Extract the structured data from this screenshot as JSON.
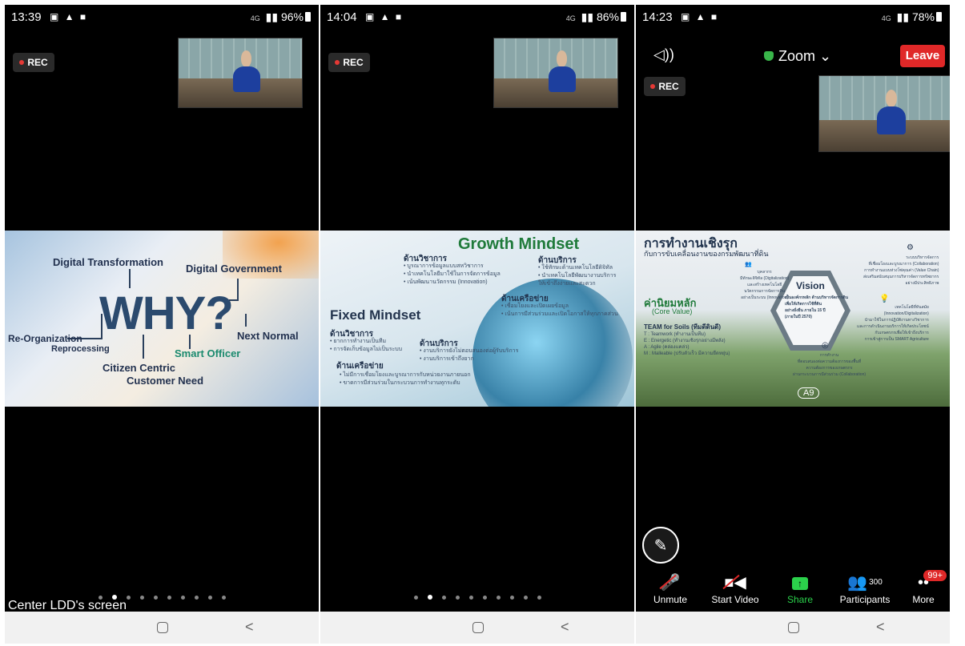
{
  "phone1": {
    "status": {
      "time": "13:39",
      "icons": "▣ ▲ ■",
      "network": "4G",
      "signal": "▮▮",
      "battery": "96%"
    },
    "rec": "REC",
    "slide": {
      "word": "WHY?",
      "labels": [
        "Digital Transformation",
        "Digital Government",
        "Re-Organization",
        "Reprocessing",
        "Next Normal",
        "Smart Officer",
        "Citizen Centric",
        "Customer Need"
      ]
    },
    "caption": "Center LDD's screen"
  },
  "phone2": {
    "status": {
      "time": "14:04",
      "icons": "▣ ▲ ■",
      "network": "4G",
      "signal": "▮▮",
      "battery": "86%"
    },
    "rec": "REC",
    "slide": {
      "growth_title": "Growth Mindset",
      "fixed_title": "Fixed Mindset",
      "g_academic_h": "ด้านวิชาการ",
      "g_academic": [
        "• บูรณาการข้อมูลแบบสหวิชาการ",
        "• นำเทคโนโลยีมาใช้ในการจัดการข้อมูล",
        "• เน้นพัฒนานวัตกรรม (Innovation)"
      ],
      "g_service_h": "ด้านบริการ",
      "g_service": [
        "• ใช้ทักษะด้านเทคโนโลยีดิจิทัล",
        "• นำเทคโนโลยีพัฒนางานบริการ",
        "ให้เข้าถึงง่ายและสะดวก"
      ],
      "g_network_h": "ด้านเครือข่าย",
      "g_network": [
        "• เชื่อมโยงและเปิดเผยข้อมูล",
        "• เน้นการมีส่วนร่วมและเปิดโอกาสให้ทุกภาคส่วน"
      ],
      "f_academic_h": "ด้านวิชาการ",
      "f_academic": [
        "• ยากการทำงานเป็นทีม",
        "• การจัดเก็บข้อมูลไม่เป็นระบบ"
      ],
      "f_service_h": "ด้านบริการ",
      "f_service": [
        "• งานบริการยังไม่ตอบสนองต่อผู้รับบริการ",
        "• งานบริการเข้าถึงยาก"
      ],
      "f_network_h": "ด้านเครือข่าย",
      "f_network": [
        "• ไม่มีการเชื่อมโยงและบูรณาการกับหน่วยงานภายนอก",
        "• ขาดการมีส่วนร่วมในกระบวนการทำงานทุกระดับ"
      ]
    }
  },
  "phone3": {
    "status": {
      "time": "14:23",
      "icons": "▣ ▲ ■",
      "network": "4G",
      "signal": "▮▮",
      "battery": "78%"
    },
    "meeting_title": "Zoom",
    "leave_label": "Leave",
    "rec": "REC",
    "slide": {
      "title": "การทำงานเชิงรุก",
      "subtitle": "กับการขับเคลื่อนงานของกรมพัฒนาที่ดิน",
      "vision": "Vision",
      "vision_text": [
        "เป็นองค์กรหลัก ด้านบริหารจัดการดิน",
        "เพื่อให้เกิดการใช้ที่ดิน",
        "อย่างยั่งยืน ภายใน 15 ปี",
        "(ภายในปี 2570)"
      ],
      "core_h": "ค่านิยมหลัก",
      "core_sub": "(Core Value)",
      "team_h": "TEAM for Soils (ทีมดีดินดี)",
      "team_items": [
        "T : Teamwork (ทำงานเป็นทีม)",
        "E : Energetic (ทำงานเชิงรุกอย่างมีพลัง)",
        "A : Agile (คล่องแคล่ว)",
        "M : Malleable (ปรับตัวเร็ว มีความยืดหยุ่น)"
      ],
      "people_h": "บุคลากร",
      "people_text": [
        "มีทักษะดิจิทัล (Digitalization)",
        "และสร้างเทคโนโลยี",
        "นวัตกรรมการจัดการดิน",
        "อย่างเป็นระบบ (Innovation)"
      ],
      "system_h": "ระบบบริหารจัดการ",
      "system_text": [
        "ที่เชื่อมโยงและบูรณาการ (Collaboration)",
        "การทำงานแบบห่วงโซ่คุณค่า (Value Chain)",
        "ส่งเสริมสนับสนุนการบริหารจัดการทรัพยากร",
        "อย่างมีประสิทธิภาพ"
      ],
      "tech_h": "เทคโนโลยีที่ทันสมัย",
      "tech_text": [
        "(Innovation/Digitalization)",
        "นำมาใช้ในการปฏิบัติงานทางวิชาการ",
        "และการดำเนินงานบริการให้เกิดประโยชน์",
        "กับเกษตรกรเพื่อให้เข้าถึงบริการ",
        "การเข้าสู่การเป็น SMART Agriculture"
      ],
      "work_h": "การทำงาน",
      "work_text": [
        "ที่ตอบสนองต่อความต้องการของพื้นที่",
        "ความต้องการของเกษตรกร",
        "ผ่านกระบวนการมีส่วนร่วม (Collaboration)"
      ],
      "badge": "A9"
    },
    "toolbar": {
      "unmute": "Unmute",
      "start_video": "Start Video",
      "share": "Share",
      "participants": "Participants",
      "participant_count": "300",
      "more": "More",
      "more_badge": "99+"
    }
  },
  "colors": {
    "leave": "#e02828",
    "share": "#2bd14b",
    "rec_dot": "#e53935"
  }
}
